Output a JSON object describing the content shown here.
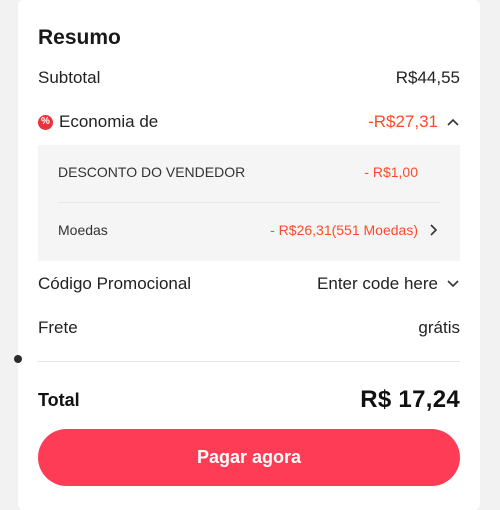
{
  "summary": {
    "title": "Resumo",
    "subtotal_label": "Subtotal",
    "subtotal_value": "R$44,55",
    "savings_label": "Economia de",
    "savings_value": "-R$27,31",
    "savings_icon": "%"
  },
  "discounts": {
    "seller_label": "DESCONTO DO VENDEDOR",
    "seller_value": "- R$1,00",
    "coins_label": "Moedas",
    "coins_value": "- R$26,31(551 Moedas)"
  },
  "promo": {
    "label": "Código Promocional",
    "value": "Enter code here"
  },
  "shipping": {
    "label": "Frete",
    "value": "grátis"
  },
  "total": {
    "label": "Total",
    "value": "R$ 17,24"
  },
  "actions": {
    "pay_label": "Pagar agora"
  },
  "colors": {
    "accent": "#ff3c55",
    "discount_red": "#ff4a2a"
  }
}
